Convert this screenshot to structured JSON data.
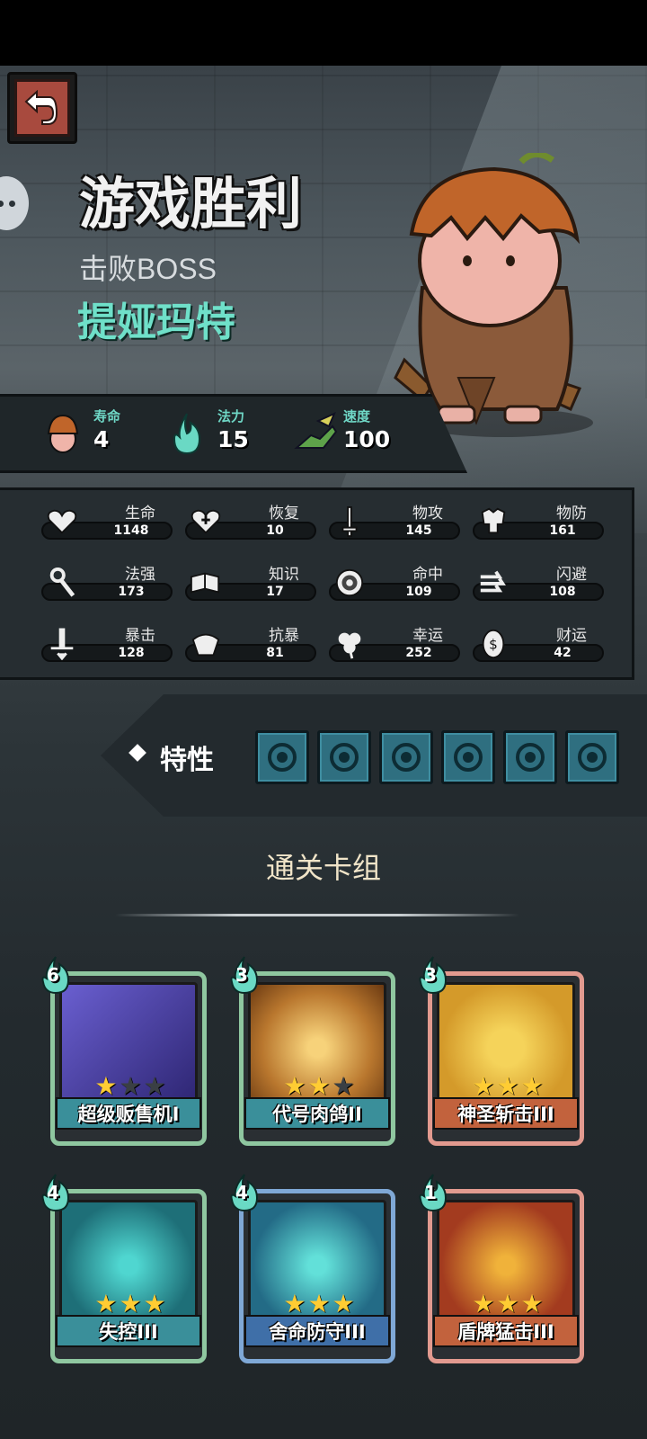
{
  "header": {
    "back_icon": "back-arrow-icon",
    "title": "游戏胜利",
    "subtitle": "击败BOSS",
    "boss_name": "提娅玛特"
  },
  "core_stats": [
    {
      "label": "寿命",
      "value": "4",
      "icon": "pumpkin-head-icon"
    },
    {
      "label": "法力",
      "value": "15",
      "icon": "mana-flame-icon"
    },
    {
      "label": "速度",
      "value": "100",
      "icon": "winged-boot-icon"
    }
  ],
  "stats": [
    {
      "label": "生命",
      "value": "1148",
      "icon": "heart-icon"
    },
    {
      "label": "恢复",
      "value": "10",
      "icon": "heart-plus-icon"
    },
    {
      "label": "物攻",
      "value": "145",
      "icon": "sword-icon"
    },
    {
      "label": "物防",
      "value": "161",
      "icon": "armor-icon"
    },
    {
      "label": "法强",
      "value": "173",
      "icon": "staff-icon"
    },
    {
      "label": "知识",
      "value": "17",
      "icon": "book-icon"
    },
    {
      "label": "命中",
      "value": "109",
      "icon": "target-icon"
    },
    {
      "label": "闪避",
      "value": "108",
      "icon": "dodge-arrows-icon"
    },
    {
      "label": "暴击",
      "value": "128",
      "icon": "crit-dagger-icon"
    },
    {
      "label": "抗暴",
      "value": "81",
      "icon": "crit-resist-icon"
    },
    {
      "label": "幸运",
      "value": "252",
      "icon": "clover-icon"
    },
    {
      "label": "财运",
      "value": "42",
      "icon": "coin-icon"
    }
  ],
  "traits": {
    "label": "特性",
    "icons": [
      "potion-trait-icon",
      "sword-trait-icon",
      "beast-trait-icon",
      "muscle-trait-icon",
      "strength-trait-icon",
      "demon-trait-icon"
    ]
  },
  "deck": {
    "title": "通关卡组",
    "cards": [
      {
        "name": "超级贩售机I",
        "cost": "6",
        "stars": 1,
        "frame": "#8fc7a0",
        "banner": "#3a8f9a",
        "art": "vending-machine-art"
      },
      {
        "name": "代号肉鸽II",
        "cost": "3",
        "stars": 2,
        "frame": "#8fc7a0",
        "banner": "#3a8f9a",
        "art": "roguelike-disc-art"
      },
      {
        "name": "神圣斩击III",
        "cost": "3",
        "stars": 3,
        "frame": "#e29a8f",
        "banner": "#c2623d",
        "art": "holy-slash-art"
      },
      {
        "name": "失控III",
        "cost": "4",
        "stars": 3,
        "frame": "#8fc7a0",
        "banner": "#3a8f9a",
        "art": "out-of-control-art"
      },
      {
        "name": "舍命防守III",
        "cost": "4",
        "stars": 3,
        "frame": "#7fa8d6",
        "banner": "#3f6fa8",
        "art": "desperate-defense-art"
      },
      {
        "name": "盾牌猛击III",
        "cost": "1",
        "stars": 3,
        "frame": "#e29a8f",
        "banner": "#c2623d",
        "art": "shield-bash-art"
      }
    ]
  }
}
